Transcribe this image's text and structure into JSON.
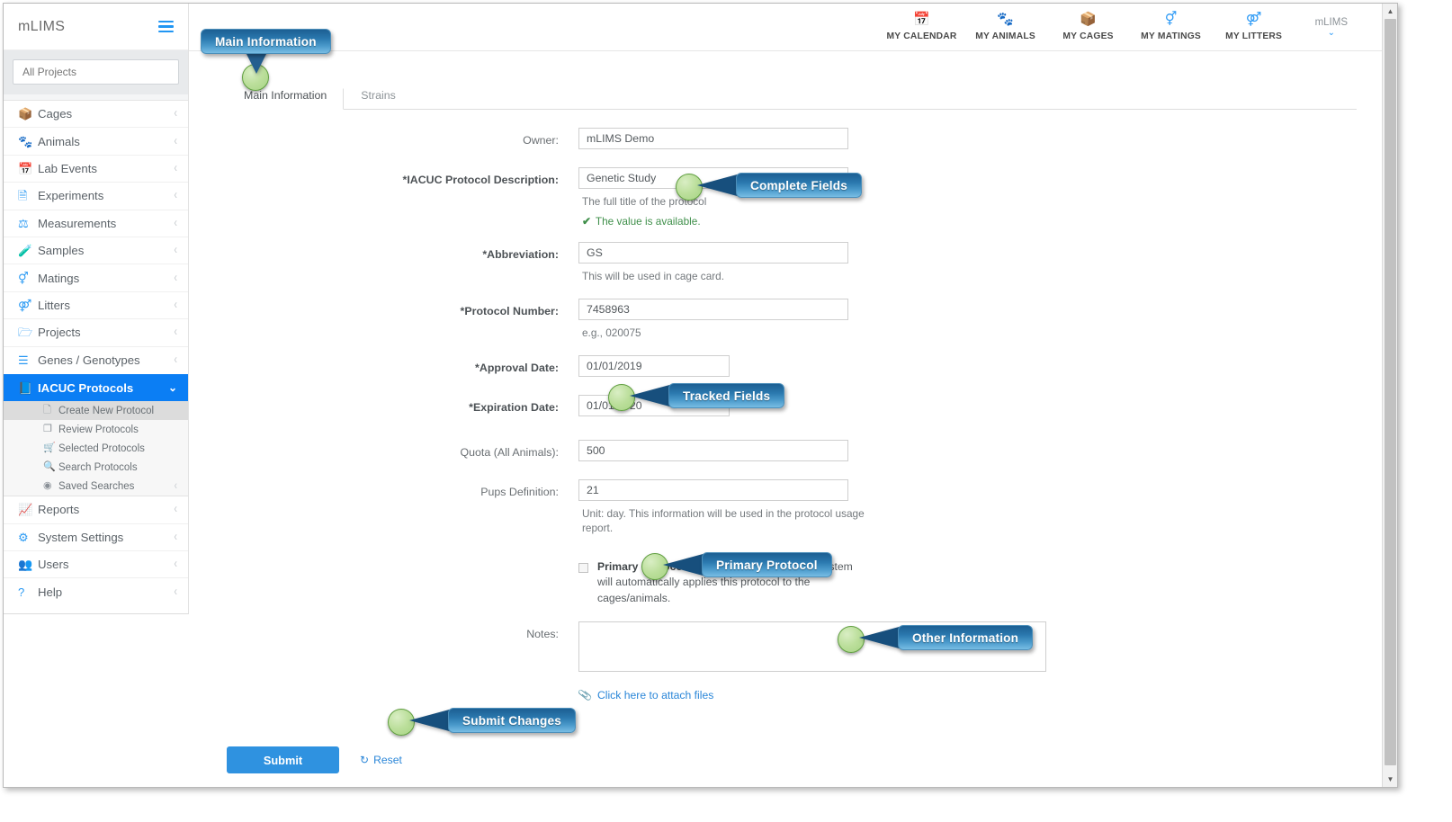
{
  "app": {
    "brand": "mLIMS",
    "menu_icon": "hamburger-icon"
  },
  "sidebar": {
    "search_placeholder": "All Projects",
    "items": [
      {
        "label": "Cages",
        "icon": "box-icon"
      },
      {
        "label": "Animals",
        "icon": "paw-icon"
      },
      {
        "label": "Lab Events",
        "icon": "calendar-icon"
      },
      {
        "label": "Experiments",
        "icon": "flask-pages-icon"
      },
      {
        "label": "Measurements",
        "icon": "scale-icon"
      },
      {
        "label": "Samples",
        "icon": "test-tube-icon"
      },
      {
        "label": "Matings",
        "icon": "mating-symbols-icon"
      },
      {
        "label": "Litters",
        "icon": "litters-icon"
      },
      {
        "label": "Projects",
        "icon": "folder-icon"
      },
      {
        "label": "Genes / Genotypes",
        "icon": "lines-icon"
      }
    ],
    "active_item": {
      "label": "IACUC Protocols",
      "icon": "book-icon"
    },
    "sub_items": [
      {
        "label": "Create New Protocol",
        "icon": "file-icon",
        "selected": true,
        "chevron": false
      },
      {
        "label": "Review Protocols",
        "icon": "copy-icon",
        "selected": false,
        "chevron": false
      },
      {
        "label": "Selected Protocols",
        "icon": "cart-icon",
        "selected": false,
        "chevron": false
      },
      {
        "label": "Search Protocols",
        "icon": "search-icon",
        "selected": false,
        "chevron": false
      },
      {
        "label": "Saved Searches",
        "icon": "target-icon",
        "selected": false,
        "chevron": true
      }
    ],
    "items_after": [
      {
        "label": "Reports",
        "icon": "chart-line-icon"
      },
      {
        "label": "System Settings",
        "icon": "gear-icon"
      },
      {
        "label": "Users",
        "icon": "users-icon"
      },
      {
        "label": "Help",
        "icon": "question-icon"
      }
    ]
  },
  "topnav": {
    "items": [
      {
        "label": "MY CALENDAR",
        "icon": "calendar-icon"
      },
      {
        "label": "MY ANIMALS",
        "icon": "paw-icon"
      },
      {
        "label": "MY CAGES",
        "icon": "box-icon"
      },
      {
        "label": "MY MATINGS",
        "icon": "mating-symbols-icon"
      },
      {
        "label": "MY LITTERS",
        "icon": "litters-icon"
      }
    ],
    "user": {
      "name": "mLIMS",
      "caret": "chevron-down-icon"
    }
  },
  "tabs": [
    {
      "label": "Main Information",
      "active": true
    },
    {
      "label": "Strains",
      "active": false
    }
  ],
  "form": {
    "owner": {
      "label": "Owner:",
      "value": "mLIMS Demo"
    },
    "description": {
      "label": "*IACUC Protocol Description:",
      "value": "Genetic Study",
      "hint": "The full title of the protocol",
      "valid_msg": "The value is available.",
      "valid_icon": "check-icon"
    },
    "abbreviation": {
      "label": "*Abbreviation:",
      "value": "GS",
      "hint": "This will be used in cage card."
    },
    "protocol_number": {
      "label": "*Protocol Number:",
      "value": "7458963",
      "hint": "e.g., 020075"
    },
    "approval_date": {
      "label": "*Approval Date:",
      "value": "01/01/2019"
    },
    "expiration_date": {
      "label": "*Expiration Date:",
      "value": "01/01/2020"
    },
    "quota": {
      "label": "Quota (All Animals):",
      "value": "500"
    },
    "pups_definition": {
      "label": "Pups Definition:",
      "value": "21",
      "hint": "Unit: day. This information will be used in the protocol usage report."
    },
    "primary_protocol": {
      "strong": "Primary Protocol",
      "text": ". If this box is checked, the system will automatically applies this protocol to the cages/animals.",
      "checked": false
    },
    "notes": {
      "label": "Notes:",
      "value": ""
    },
    "attach": {
      "label": "Click here to attach files",
      "icon": "paperclip-icon"
    },
    "submit_label": "Submit",
    "reset_label": "Reset",
    "reset_icon": "refresh-icon"
  },
  "callouts": [
    {
      "id": "main-information",
      "label": "Main Information"
    },
    {
      "id": "complete-fields",
      "label": "Complete Fields"
    },
    {
      "id": "tracked-fields",
      "label": "Tracked Fields"
    },
    {
      "id": "primary-protocol",
      "label": "Primary Protocol"
    },
    {
      "id": "other-information",
      "label": "Other Information"
    },
    {
      "id": "submit-changes",
      "label": "Submit Changes"
    }
  ],
  "colors": {
    "accent_blue": "#2f9bf5",
    "active_nav": "#0b7ef4",
    "callout_dark": "#1c5f93",
    "callout_light": "#78bde4",
    "marker_green": "#bcdf9c",
    "valid_green": "#3f8f4a",
    "link_blue": "#2a86d8"
  }
}
